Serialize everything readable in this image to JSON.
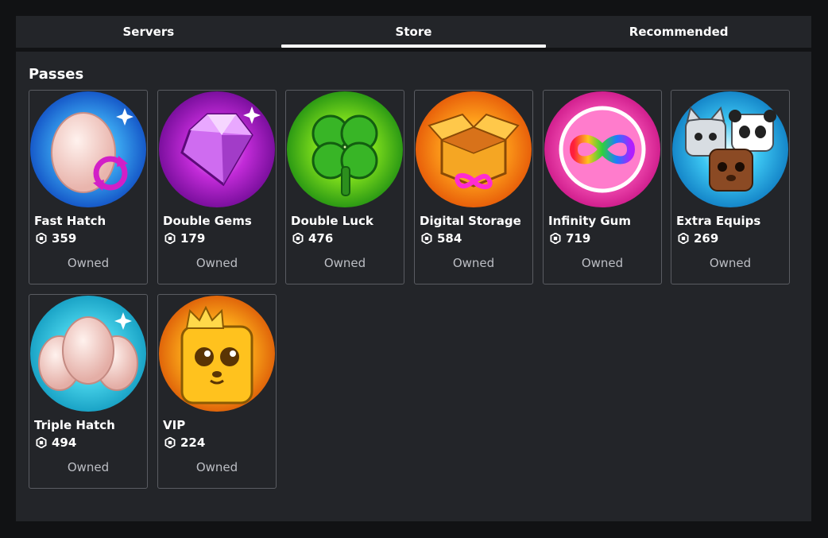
{
  "tabs": [
    {
      "label": "Servers"
    },
    {
      "label": "Store",
      "active": true
    },
    {
      "label": "Recommended"
    }
  ],
  "section_title": "Passes",
  "passes": [
    {
      "name": "Fast Hatch",
      "price": "359",
      "status": "Owned",
      "icon": "egg-refresh-icon"
    },
    {
      "name": "Double Gems",
      "price": "179",
      "status": "Owned",
      "icon": "gem-icon"
    },
    {
      "name": "Double Luck",
      "price": "476",
      "status": "Owned",
      "icon": "clover-icon"
    },
    {
      "name": "Digital Storage",
      "price": "584",
      "status": "Owned",
      "icon": "storage-box-icon"
    },
    {
      "name": "Infinity Gum",
      "price": "719",
      "status": "Owned",
      "icon": "infinity-gum-icon"
    },
    {
      "name": "Extra Equips",
      "price": "269",
      "status": "Owned",
      "icon": "pets-icon"
    },
    {
      "name": "Triple Hatch",
      "price": "494",
      "status": "Owned",
      "icon": "triple-egg-icon"
    },
    {
      "name": "VIP",
      "price": "224",
      "status": "Owned",
      "icon": "vip-dog-icon"
    }
  ],
  "colors": {
    "background": "#111214",
    "panel": "#232529",
    "card_border": "#5a5c62",
    "owned_text": "#bcbec4"
  }
}
